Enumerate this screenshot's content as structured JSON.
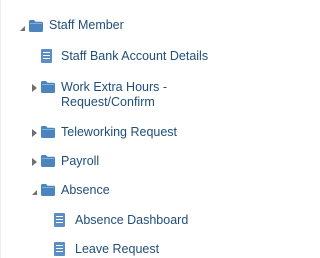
{
  "tree": {
    "staff_member": "Staff Member",
    "staff_bank": "Staff Bank Account Details",
    "work_extra": "Work Extra Hours - Request/Confirm",
    "teleworking": "Teleworking Request",
    "payroll": "Payroll",
    "absence": "Absence",
    "absence_dashboard": "Absence Dashboard",
    "leave_request": "Leave Request"
  },
  "icons": {
    "expanded": "triangle-down-icon",
    "collapsed": "triangle-right-icon",
    "folder": "folder-icon",
    "page": "page-icon"
  },
  "colors": {
    "link_text": "#1f4e79",
    "folder_fill": "#4c85bd",
    "folder_tab": "#5f93c8"
  }
}
